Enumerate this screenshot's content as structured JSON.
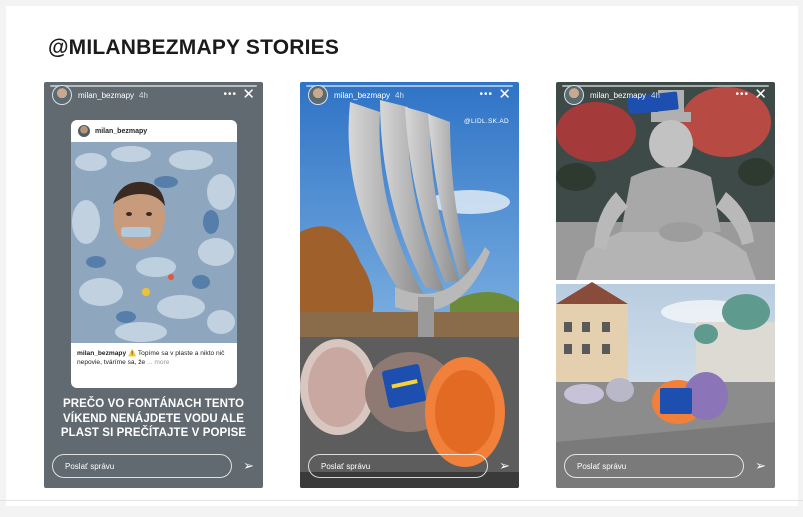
{
  "page": {
    "title": "@MILANBEZMAPY STORIES"
  },
  "stories": [
    {
      "username": "milan_bezmapy",
      "age": "4h",
      "more": "•••",
      "close": "✕",
      "post": {
        "username": "milan_bezmapy",
        "caption_user": "milan_bezmapy",
        "caption_emoji": "⚠️",
        "caption_text": " Topíme sa v plaste a nikto nič nepovie, tváríme sa, že",
        "caption_more": " ... more"
      },
      "text": "PREČO VO FONTÁNACH TENTO VÍKEND NENÁJDETE VODU ALE PLAST SI PREČÍTAJTE V POPISE",
      "reply_placeholder": "Poslať správu",
      "send": "➢"
    },
    {
      "username": "milan_bezmapy",
      "age": "4h",
      "more": "•••",
      "close": "✕",
      "tag": "@LIDL.SK.AD",
      "reply_placeholder": "Poslať správu",
      "send": "➢"
    },
    {
      "username": "milan_bezmapy",
      "age": "4h",
      "more": "•••",
      "close": "✕",
      "reply_placeholder": "Poslať správu",
      "send": "➢"
    }
  ],
  "colors": {
    "title": "#1b1b1b",
    "story1_bg": "#606a70",
    "sky": "#4d8fd4",
    "net_orange": "#f0803a",
    "sign_blue": "#1d4fb0"
  }
}
